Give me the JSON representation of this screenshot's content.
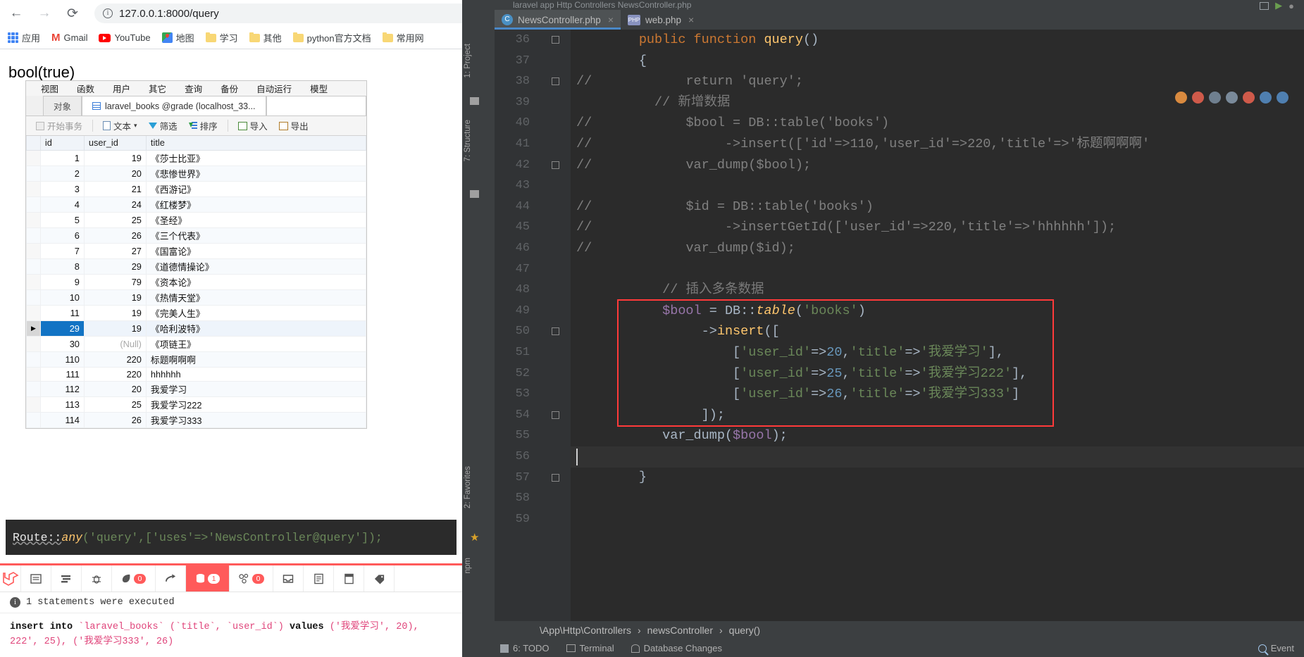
{
  "browser": {
    "nav": {
      "back": "←",
      "forward": "→",
      "reload": "⟳"
    },
    "omnibox": {
      "url": "127.0.0.1:8000/query",
      "info_icon": "info-icon",
      "translate_icon": "translate-icon",
      "star_icon": "bookmark-star-icon"
    },
    "bookmarks": [
      {
        "label": "应用",
        "icon": "apps-grid-icon"
      },
      {
        "label": "Gmail",
        "icon": "gmail-icon"
      },
      {
        "label": "YouTube",
        "icon": "youtube-icon"
      },
      {
        "label": "地图",
        "icon": "maps-icon"
      },
      {
        "label": "学习",
        "icon": "folder-icon"
      },
      {
        "label": "其他",
        "icon": "folder-icon"
      },
      {
        "label": "python官方文档",
        "icon": "folder-icon"
      },
      {
        "label": "常用网",
        "icon": "folder-icon"
      }
    ],
    "page_output": "bool(true)"
  },
  "navicat": {
    "menu": [
      "视图",
      "函数",
      "用户",
      "其它",
      "查询",
      "备份",
      "自动运行",
      "模型"
    ],
    "tabs": [
      {
        "label": "对象",
        "active": false
      },
      {
        "label": "laravel_books @grade (localhost_33...",
        "active": true
      }
    ],
    "toolbar": [
      {
        "label": "开始事务",
        "icon": "transaction-icon",
        "disabled": true
      },
      {
        "label": "文本",
        "icon": "text-icon",
        "caret": "▾"
      },
      {
        "label": "筛选",
        "icon": "filter-icon"
      },
      {
        "label": "排序",
        "icon": "sort-icon"
      },
      {
        "label": "导入",
        "icon": "import-icon"
      },
      {
        "label": "导出",
        "icon": "export-icon"
      }
    ],
    "grid": {
      "columns": [
        "id",
        "user_id",
        "title"
      ],
      "selected_row_id": "29",
      "rows": [
        {
          "id": "1",
          "user_id": "19",
          "title": "《莎士比亚》"
        },
        {
          "id": "2",
          "user_id": "20",
          "title": "《悲惨世界》"
        },
        {
          "id": "3",
          "user_id": "21",
          "title": "《西游记》"
        },
        {
          "id": "4",
          "user_id": "24",
          "title": "《红楼梦》"
        },
        {
          "id": "5",
          "user_id": "25",
          "title": "《圣经》"
        },
        {
          "id": "6",
          "user_id": "26",
          "title": "《三个代表》"
        },
        {
          "id": "7",
          "user_id": "27",
          "title": "《国富论》"
        },
        {
          "id": "8",
          "user_id": "29",
          "title": "《道德情操论》"
        },
        {
          "id": "9",
          "user_id": "79",
          "title": "《资本论》"
        },
        {
          "id": "10",
          "user_id": "19",
          "title": "《热情天堂》"
        },
        {
          "id": "11",
          "user_id": "19",
          "title": "《完美人生》"
        },
        {
          "id": "29",
          "user_id": "19",
          "title": "《哈利波特》"
        },
        {
          "id": "30",
          "user_id": "(Null)",
          "title": "《项链王》"
        },
        {
          "id": "110",
          "user_id": "220",
          "title": "标题啊啊啊"
        },
        {
          "id": "111",
          "user_id": "220",
          "title": "hhhhhh"
        },
        {
          "id": "112",
          "user_id": "20",
          "title": "我爱学习"
        },
        {
          "id": "113",
          "user_id": "25",
          "title": "我爱学习222"
        },
        {
          "id": "114",
          "user_id": "26",
          "title": "我爱学习333"
        }
      ]
    }
  },
  "route_code": {
    "prefix": "Route::",
    "fn": "any",
    "rest": "('query',['uses'=>'NewsController@query']);"
  },
  "debugbar": {
    "tabs": [
      {
        "icon": "laravel-logo-icon",
        "label": "",
        "badge": "",
        "active": false
      },
      {
        "icon": "messages-icon",
        "label": "",
        "badge": "",
        "active": false
      },
      {
        "icon": "timeline-icon",
        "label": "",
        "badge": "",
        "active": false
      },
      {
        "icon": "exceptions-bug-icon",
        "label": "",
        "badge": "",
        "active": false
      },
      {
        "icon": "views-leaf-icon",
        "label": "",
        "badge": "0",
        "active": false
      },
      {
        "icon": "route-arrow-icon",
        "label": "",
        "badge": "",
        "active": false
      },
      {
        "icon": "queries-database-icon",
        "label": "",
        "badge": "1",
        "active": true
      },
      {
        "icon": "models-cubes-icon",
        "label": "",
        "badge": "0",
        "active": false
      },
      {
        "icon": "mails-inbox-icon",
        "label": "",
        "badge": "",
        "active": false
      },
      {
        "icon": "request-icon",
        "label": "",
        "badge": "",
        "active": false
      },
      {
        "icon": "session-icon",
        "label": "",
        "badge": "",
        "active": false
      },
      {
        "icon": "tag-icon",
        "label": "",
        "badge": "",
        "active": false
      }
    ],
    "status": "1 statements were executed",
    "sql": {
      "line1_kw": "insert into",
      "line1_table": "`laravel_books`",
      "line1_cols": "(`title`, `user_id`)",
      "line1_values_kw": "values",
      "line1_rest": "('我爱学习', 20),",
      "line2": "222', 25), ('我爱学习333', 26)"
    }
  },
  "ide": {
    "breadcrumb_top": "laravel  app  Http  Controllers  NewsController.php",
    "tabs": [
      {
        "label": "NewsController.php",
        "icon": "php-class-icon",
        "active": true,
        "close": "×"
      },
      {
        "label": "web.php",
        "icon": "php-file-icon",
        "active": false,
        "close": "×"
      }
    ],
    "left_tools": [
      "1: Project",
      "7: Structure",
      "2: Favorites",
      "npm"
    ],
    "code_lines": [
      {
        "n": "36",
        "fold": "minus",
        "tokens": [
          [
            "kw",
            "        public "
          ],
          [
            "kw",
            "function "
          ],
          [
            "fn",
            "query"
          ],
          [
            "pun",
            "()"
          ]
        ]
      },
      {
        "n": "37",
        "fold": "",
        "tokens": [
          [
            "pun",
            "        {"
          ]
        ]
      },
      {
        "n": "38",
        "fold": "minus",
        "tokens": [
          [
            "cmt",
            "//"
          ],
          [
            "cmt",
            "            return 'query';"
          ]
        ]
      },
      {
        "n": "39",
        "fold": "",
        "tokens": [
          [
            "cmt",
            "          // "
          ],
          [
            "cmt-cn",
            "新增数据"
          ]
        ]
      },
      {
        "n": "40",
        "fold": "",
        "tokens": [
          [
            "cmt",
            "//"
          ],
          [
            "cmt",
            "            $bool = DB::table('books')"
          ]
        ]
      },
      {
        "n": "41",
        "fold": "",
        "tokens": [
          [
            "cmt",
            "//"
          ],
          [
            "cmt",
            "                 ->insert(['id'=>110,'user_id'=>220,'title'=>'标题啊啊啊'"
          ]
        ]
      },
      {
        "n": "42",
        "fold": "minus",
        "tokens": [
          [
            "cmt",
            "//"
          ],
          [
            "cmt",
            "            var_dump($bool);"
          ]
        ]
      },
      {
        "n": "43",
        "fold": "",
        "tokens": [
          [
            "pun",
            ""
          ]
        ]
      },
      {
        "n": "44",
        "fold": "",
        "tokens": [
          [
            "cmt",
            "//"
          ],
          [
            "cmt",
            "            $id = DB::table('books')"
          ]
        ]
      },
      {
        "n": "45",
        "fold": "",
        "tokens": [
          [
            "cmt",
            "//"
          ],
          [
            "cmt",
            "                 ->insertGetId(['user_id'=>220,'title'=>'hhhhhh']);"
          ]
        ]
      },
      {
        "n": "46",
        "fold": "",
        "tokens": [
          [
            "cmt",
            "//"
          ],
          [
            "cmt",
            "            var_dump($id);"
          ]
        ]
      },
      {
        "n": "47",
        "fold": "",
        "tokens": [
          [
            "pun",
            ""
          ]
        ]
      },
      {
        "n": "48",
        "fold": "",
        "tokens": [
          [
            "cmt",
            "           // "
          ],
          [
            "cmt-cn",
            "插入多条数据"
          ]
        ]
      },
      {
        "n": "49",
        "fold": "",
        "tokens": [
          [
            "var",
            "           $bool "
          ],
          [
            "pun",
            "= "
          ],
          [
            "cls",
            "DB"
          ],
          [
            "pun",
            "::"
          ],
          [
            "mth",
            "table"
          ],
          [
            "pun",
            "("
          ],
          [
            "str",
            "'books'"
          ],
          [
            "pun",
            ")"
          ]
        ]
      },
      {
        "n": "50",
        "fold": "minus",
        "tokens": [
          [
            "pun",
            "                ->"
          ],
          [
            "fn",
            "insert"
          ],
          [
            "pun",
            "(["
          ]
        ]
      },
      {
        "n": "51",
        "fold": "",
        "tokens": [
          [
            "pun",
            "                    ["
          ],
          [
            "str",
            "'user_id'"
          ],
          [
            "pun",
            "=>"
          ],
          [
            "num",
            "20"
          ],
          [
            "pun",
            ","
          ],
          [
            "str",
            "'title'"
          ],
          [
            "pun",
            "=>"
          ],
          [
            "str",
            "'我爱学习'"
          ],
          [
            "pun",
            "],"
          ]
        ]
      },
      {
        "n": "52",
        "fold": "",
        "tokens": [
          [
            "pun",
            "                    ["
          ],
          [
            "str",
            "'user_id'"
          ],
          [
            "pun",
            "=>"
          ],
          [
            "num",
            "25"
          ],
          [
            "pun",
            ","
          ],
          [
            "str",
            "'title'"
          ],
          [
            "pun",
            "=>"
          ],
          [
            "str",
            "'我爱学习222'"
          ],
          [
            "pun",
            "],"
          ]
        ]
      },
      {
        "n": "53",
        "fold": "",
        "tokens": [
          [
            "pun",
            "                    ["
          ],
          [
            "str",
            "'user_id'"
          ],
          [
            "pun",
            "=>"
          ],
          [
            "num",
            "26"
          ],
          [
            "pun",
            ","
          ],
          [
            "str",
            "'title'"
          ],
          [
            "pun",
            "=>"
          ],
          [
            "str",
            "'我爱学习333'"
          ],
          [
            "pun",
            "]"
          ]
        ]
      },
      {
        "n": "54",
        "fold": "minus",
        "tokens": [
          [
            "pun",
            "                ]);"
          ]
        ]
      },
      {
        "n": "55",
        "fold": "",
        "tokens": [
          [
            "pun",
            "           var_dump("
          ],
          [
            "var",
            "$bool"
          ],
          [
            "pun",
            ");"
          ]
        ]
      },
      {
        "n": "56",
        "fold": "",
        "tokens": [
          [
            "pun",
            ""
          ]
        ]
      },
      {
        "n": "57",
        "fold": "minus",
        "tokens": [
          [
            "pun",
            "        }"
          ]
        ]
      },
      {
        "n": "58",
        "fold": "",
        "tokens": [
          [
            "pun",
            ""
          ]
        ]
      },
      {
        "n": "59",
        "fold": "",
        "tokens": [
          [
            "pun",
            ""
          ]
        ]
      }
    ],
    "breadcrumbs": [
      "\\App\\Http\\Controllers",
      "newsController",
      "query()"
    ],
    "breadcrumb_sep": "›",
    "status_items": [
      {
        "label": "6: TODO",
        "icon": "todo-icon"
      },
      {
        "label": "Terminal",
        "icon": "terminal-icon"
      },
      {
        "label": "Database Changes",
        "icon": "database-icon"
      }
    ],
    "status_right": {
      "label": "Event",
      "icon": "event-log-icon"
    }
  }
}
